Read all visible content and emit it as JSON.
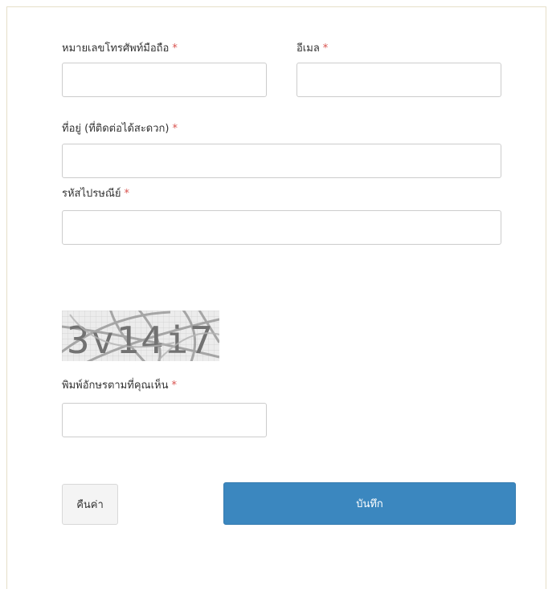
{
  "form": {
    "required_mark": "*",
    "phone": {
      "label": "หมายเลขโทรศัพท์มือถือ",
      "value": ""
    },
    "email": {
      "label": "อีเมล",
      "value": ""
    },
    "address": {
      "label": "ที่อยู่ (ที่ติดต่อได้สะดวก)",
      "value": ""
    },
    "postal_code": {
      "label": "รหัสไปรษณีย์",
      "value": ""
    },
    "captcha": {
      "image_text": "3v14i7",
      "label": "พิมพ์อักษรตามที่คุณเห็น",
      "value": ""
    }
  },
  "buttons": {
    "reset_label": "คืนค่า",
    "save_label": "บันทึก"
  },
  "colors": {
    "required": "#d9534f",
    "save_button": "#3b87bf",
    "reset_button": "#f4f4f4",
    "input_border": "#cccccc",
    "panel_border": "#e6dfc8"
  }
}
